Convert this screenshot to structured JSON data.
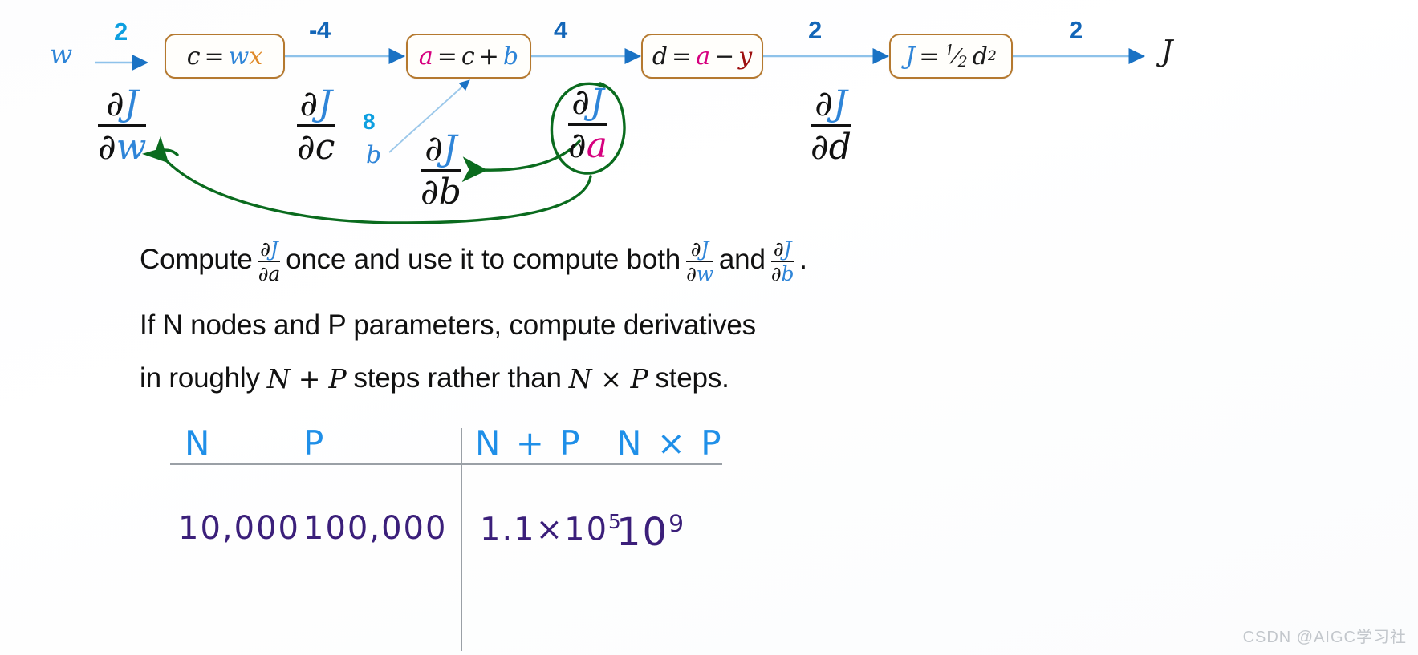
{
  "graph": {
    "input_label": "w",
    "output_label": "J",
    "edge_values": {
      "w_to_c": "2",
      "c_to_a": "-4",
      "a_to_d": "4",
      "d_to_J": "2",
      "J_out": "2",
      "b_to_a": "8"
    },
    "b_label": "b",
    "nodes": [
      {
        "id": "c",
        "lhs": "c",
        "eq": "=",
        "rhs_1": "w",
        "rhs_2": "x",
        "text": "c = wx"
      },
      {
        "id": "a",
        "lhs": "a",
        "eq": "=",
        "rhs_1": "c",
        "op": "+",
        "rhs_2": "b",
        "text": "a = c + b"
      },
      {
        "id": "d",
        "lhs": "d",
        "eq": "=",
        "rhs_1": "a",
        "op": "−",
        "rhs_2": "y",
        "text": "d = a − y"
      },
      {
        "id": "J",
        "lhs": "J",
        "eq": "=",
        "frac_num": "1",
        "frac_den": "2",
        "rhs_2": "d",
        "exp": "2",
        "text": "J = 1/2 d²"
      }
    ],
    "derivatives": [
      {
        "id": "dJdw",
        "num_partial": "∂",
        "num_var": "J",
        "den_partial": "∂",
        "den_var": "w",
        "label": "dJ/dw"
      },
      {
        "id": "dJdc",
        "num_partial": "∂",
        "num_var": "J",
        "den_partial": "∂",
        "den_var": "c",
        "label": "dJ/dc"
      },
      {
        "id": "dJdb",
        "num_partial": "∂",
        "num_var": "J",
        "den_partial": "∂",
        "den_var": "b",
        "label": "dJ/db"
      },
      {
        "id": "dJda",
        "num_partial": "∂",
        "num_var": "J",
        "den_partial": "∂",
        "den_var": "a",
        "label": "dJ/da"
      },
      {
        "id": "dJdd",
        "num_partial": "∂",
        "num_var": "J",
        "den_partial": "∂",
        "den_var": "d",
        "label": "dJ/dd"
      }
    ],
    "colors": {
      "box_border": "#b5792f",
      "arrow_blue": "#8ec2ea",
      "arrow_head": "#1a72c4",
      "number_blue": "#1366b8",
      "var_blue": "#2f85d8",
      "var_orange": "#e08a2a",
      "var_magenta": "#d6007f",
      "var_darkred": "#9e1010",
      "annotation_green": "#0a6b1e"
    }
  },
  "prose": {
    "line1": {
      "part1": "Compute",
      "frac1_num": "∂J",
      "frac1_den": "∂a",
      "part2": "once and use it to compute both",
      "frac2_num": "∂J",
      "frac2_den": "∂w",
      "part3": "and",
      "frac3_num": "∂J",
      "frac3_den": "∂b",
      "part4": "."
    },
    "line2": "If N nodes and P parameters, compute derivatives",
    "line3": {
      "part1": "in roughly",
      "math1": "N + P",
      "part2": "steps rather than",
      "math2": "N × P",
      "part3": "steps."
    }
  },
  "table": {
    "headers": [
      "N",
      "P",
      "N + P",
      "N × P"
    ],
    "rows": [
      {
        "N": "10,000",
        "P": "100,000",
        "N_plus_P_mantissa": "1.1×10",
        "N_plus_P_exp": "5",
        "N_times_P_mantissa": "10",
        "N_times_P_exp": "9"
      }
    ]
  },
  "watermark": "CSDN @AIGC学习社"
}
